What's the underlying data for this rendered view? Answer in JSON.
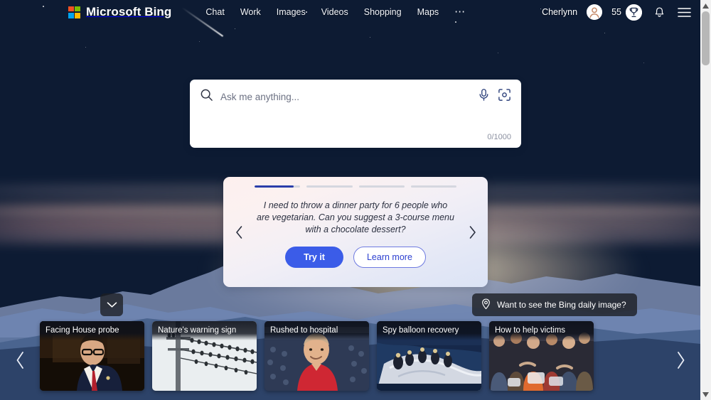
{
  "header": {
    "brand": "Microsoft Bing",
    "logo_icon": "microsoft-logo",
    "logo_colors": [
      "#f25022",
      "#7fba00",
      "#00a4ef",
      "#ffb900"
    ],
    "nav": [
      {
        "label": "Chat",
        "name": "chat"
      },
      {
        "label": "Work",
        "name": "work"
      },
      {
        "label": "Images",
        "name": "images"
      },
      {
        "label": "Videos",
        "name": "videos"
      },
      {
        "label": "Shopping",
        "name": "shopping"
      },
      {
        "label": "Maps",
        "name": "maps"
      }
    ],
    "more_label": "⋯",
    "more_icon": "ellipsis-icon",
    "user_name": "Cherlynn",
    "avatar_icon": "account-avatar-icon",
    "rewards_count": "55",
    "rewards_icon": "trophy-icon",
    "notifications_icon": "bell-icon",
    "menu_icon": "hamburger-menu-icon"
  },
  "search": {
    "placeholder": "Ask me anything...",
    "value": "",
    "search_icon": "search-icon",
    "mic_icon": "microphone-icon",
    "lens_icon": "visual-search-icon",
    "char_count": "0/1000"
  },
  "suggestion_card": {
    "prompt": "I need to throw a dinner party for 6 people who are vegetarian. Can you suggest a 3-course menu with a chocolate dessert?",
    "try_label": "Try it",
    "learn_label": "Learn more",
    "prev_icon": "chevron-left-icon",
    "next_icon": "chevron-right-icon",
    "progress": [
      85,
      0,
      0,
      0
    ],
    "accent_color": "#2a3eaa",
    "primary_button_color": "#3b5ce8"
  },
  "daily_image_pill": {
    "label": "Want to see the Bing daily image?",
    "icon": "location-pin-icon"
  },
  "collapse_button": {
    "icon": "chevron-down-icon"
  },
  "news": {
    "prev_icon": "chevron-left-icon",
    "next_icon": "chevron-right-icon",
    "cards": [
      {
        "title": "Facing House probe",
        "name": "news-card-facing-house-probe"
      },
      {
        "title": "Nature's warning sign",
        "name": "news-card-natures-warning-sign"
      },
      {
        "title": "Rushed to hospital",
        "name": "news-card-rushed-to-hospital"
      },
      {
        "title": "Spy balloon recovery",
        "name": "news-card-spy-balloon-recovery"
      },
      {
        "title": "How to help victims",
        "name": "news-card-how-to-help-victims"
      }
    ]
  },
  "scrollbar": {
    "up_icon": "scroll-up-arrow-icon",
    "down_icon": "scroll-down-arrow-icon",
    "thumb": "scrollbar-thumb"
  }
}
